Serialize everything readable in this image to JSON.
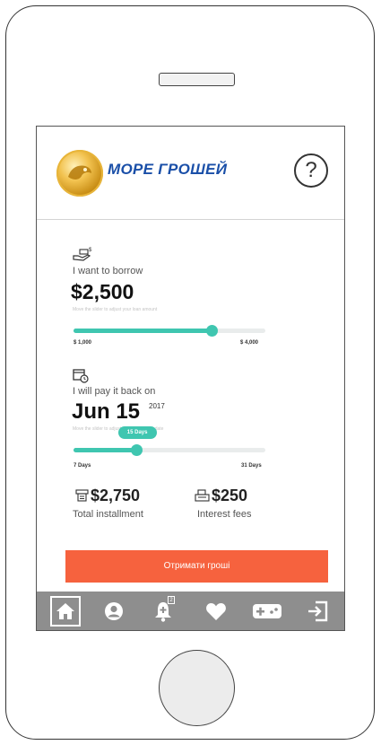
{
  "header": {
    "brand": "МОРЕ ГРОШЕЙ",
    "help_icon": "?"
  },
  "borrow": {
    "icon": "money-hand-icon",
    "title": "I want to borrow",
    "amount": "$2,500",
    "hint": "Move the slider to adjust your loan amount",
    "min_label": "$ 1,000",
    "max_label": "$ 4,000",
    "slider_value": 0.72
  },
  "payback": {
    "icon": "calendar-clock-icon",
    "title": "I will pay it back on",
    "day": "Jun 15",
    "year": "2017",
    "hint": "Move the slider to adjust your repayment date",
    "bubble": "15 Days",
    "min_label": "7 Days",
    "max_label": "31 Days",
    "slider_value": 0.33
  },
  "summary": {
    "installment_value": "$2,750",
    "installment_label": "Total installment",
    "fees_value": "$250",
    "fees_label": "Interest fees"
  },
  "cta": {
    "label": "Отримати гроші"
  },
  "tabbar": {
    "items": [
      "home-icon",
      "user-icon",
      "bell-icon",
      "heart-icon",
      "gamepad-icon",
      "sign-in-icon"
    ],
    "notification_count": "2"
  },
  "colors": {
    "accent": "#3fc6b0",
    "cta": "#f6623e",
    "brand": "#1a4fa8",
    "tabbar": "#8e8e8e"
  }
}
